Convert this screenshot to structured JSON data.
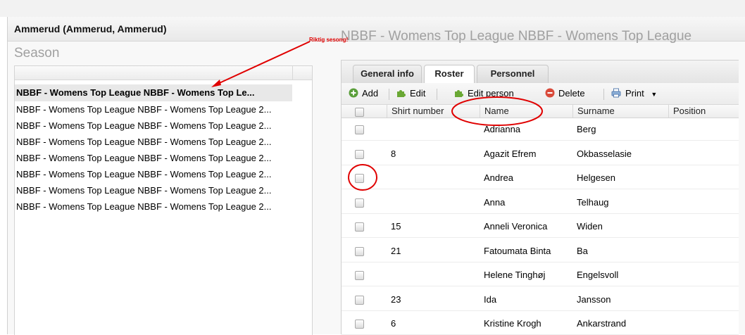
{
  "window": {
    "title": "Ammerud (Ammerud, Ammerud)"
  },
  "season": {
    "label": "Season",
    "selected": "NBBF - Womens Top League NBBF - Womens Top Le...",
    "items": [
      "NBBF - Womens Top League NBBF - Womens Top League 2...",
      "NBBF - Womens Top League NBBF - Womens Top League 2...",
      "NBBF - Womens Top League NBBF - Womens Top League 2...",
      "NBBF - Womens Top League NBBF - Womens Top League 2...",
      "NBBF - Womens Top League NBBF - Womens Top League 2...",
      "NBBF - Womens Top League NBBF - Womens Top League 2...",
      "NBBF - Womens Top League NBBF - Womens Top League 2..."
    ]
  },
  "team": {
    "label": "NBBF - Womens Top League NBBF - Womens Top League"
  },
  "tabs": [
    "General info",
    "Roster",
    "Personnel"
  ],
  "toolbar": {
    "add": "Add",
    "edit": "Edit",
    "edit_person": "Edit person",
    "delete": "Delete",
    "print": "Print"
  },
  "columns": {
    "shirt": "Shirt number",
    "name": "Name",
    "surname": "Surname",
    "position": "Position"
  },
  "roster": [
    {
      "shirt": "",
      "name": "Adrianna",
      "surname": "Berg",
      "position": ""
    },
    {
      "shirt": "8",
      "name": "Agazit Efrem",
      "surname": "Okbasselasie",
      "position": ""
    },
    {
      "shirt": "",
      "name": "Andrea",
      "surname": "Helgesen",
      "position": ""
    },
    {
      "shirt": "",
      "name": "Anna",
      "surname": "Telhaug",
      "position": ""
    },
    {
      "shirt": "15",
      "name": "Anneli Veronica",
      "surname": "Widen",
      "position": ""
    },
    {
      "shirt": "21",
      "name": "Fatoumata Binta",
      "surname": "Ba",
      "position": ""
    },
    {
      "shirt": "",
      "name": "Helene Tinghøj",
      "surname": "Engelsvoll",
      "position": ""
    },
    {
      "shirt": "23",
      "name": "Ida",
      "surname": "Jansson",
      "position": ""
    },
    {
      "shirt": "6",
      "name": "Kristine Krogh",
      "surname": "Ankarstrand",
      "position": ""
    }
  ],
  "annotation": {
    "note": "Riktig sesong!",
    "color": "#e00000"
  }
}
